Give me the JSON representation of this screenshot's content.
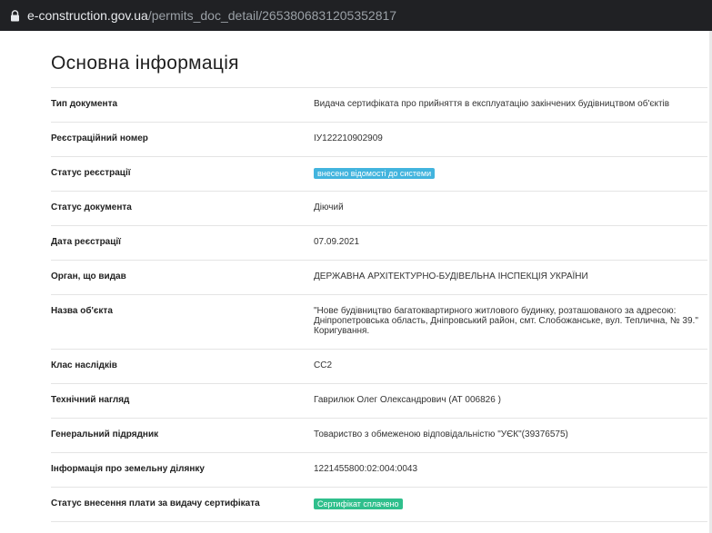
{
  "browser": {
    "url_host": "e-construction.gov.ua",
    "url_path": "/permits_doc_detail/2653806831205352817"
  },
  "page": {
    "title": "Основна інформація"
  },
  "rows": [
    {
      "label": "Тип документа",
      "value": "Видача сертифіката про прийняття в експлуатацію закінчених будівництвом об'єктів"
    },
    {
      "label": "Реєстраційний номер",
      "value": "ІУ122210902909"
    },
    {
      "label": "Статус реєстрації",
      "value": "внесено відомості до системи"
    },
    {
      "label": "Статус документа",
      "value": "Діючий"
    },
    {
      "label": "Дата реєстрації",
      "value": "07.09.2021"
    },
    {
      "label": "Орган, що видав",
      "value": "ДЕРЖАВНА АРХІТЕКТУРНО-БУДІВЕЛЬНА ІНСПЕКЦІЯ УКРАЇНИ"
    },
    {
      "label": "Назва об'єкта",
      "value": "\"Нове будівництво багатоквартирного житлового будинку, розташованого за адресою: Дніпропетровська область, Дніпровський район, смт. Слобожанське, вул. Теплична, № 39.\" Коригування."
    },
    {
      "label": "Клас наслідків",
      "value": "СС2"
    },
    {
      "label": "Технічний нагляд",
      "value": "Гаврилюк Олег Олександрович (АТ 006826 )"
    },
    {
      "label": "Генеральний підрядник",
      "value": "Товариство з обмеженою відповідальністю \"УЄК\"(39376575)"
    },
    {
      "label": "Інформація про земельну ділянку",
      "value": "1221455800:02:004:0043"
    },
    {
      "label": "Статус внесення плати за видачу сертифіката",
      "value": "Сертифікат сплачено"
    }
  ],
  "colors": {
    "badge_registration": "#42b4de",
    "badge_payment": "#2fbf8c"
  }
}
